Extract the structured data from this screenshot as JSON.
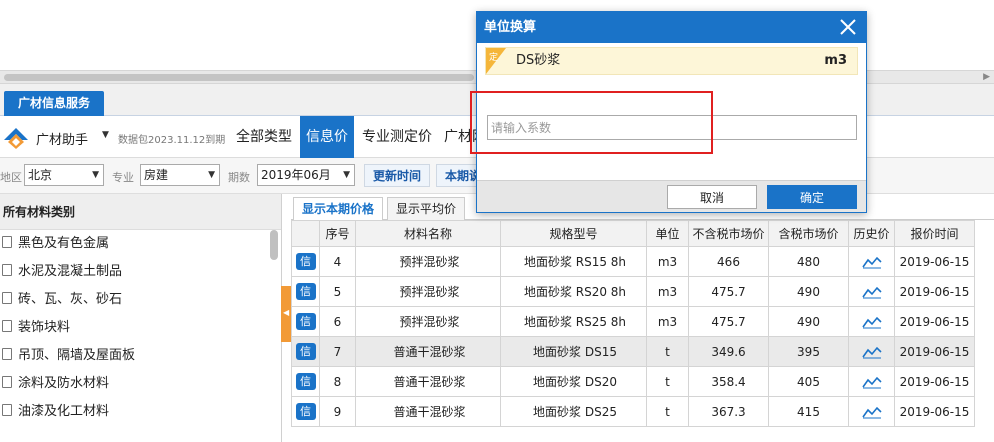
{
  "app_tab": "广材信息服务",
  "toolbar": {
    "brand": "广材助手",
    "data_package": "数据包2023.11.12到期",
    "tabs": [
      "全部类型",
      "信息价",
      "专业测定价",
      "广材网"
    ],
    "active_tab": "信息价"
  },
  "filters": {
    "region_label": "地区",
    "region_value": "北京",
    "major_label": "专业",
    "major_value": "房建",
    "period_label": "期数",
    "period_value": "2019年06月",
    "update_button": "更新时间",
    "current_button": "本期说明"
  },
  "categories": {
    "header": "所有材料类别",
    "items": [
      "黑色及有色金属",
      "水泥及混凝土制品",
      "砖、瓦、灰、砂石",
      "装饰块料",
      "吊顶、隔墙及屋面板",
      "涂料及防水材料",
      "油漆及化工材料"
    ]
  },
  "subtabs": [
    "显示本期价格",
    "显示平均价"
  ],
  "table": {
    "columns": [
      "",
      "序号",
      "材料名称",
      "规格型号",
      "单位",
      "不含税市场价",
      "含税市场价",
      "历史价",
      "报价时间"
    ],
    "badge": "信",
    "rows": [
      {
        "no": "4",
        "name": "预拌混砂浆",
        "spec": "地面砂浆 RS15 8h",
        "unit": "m3",
        "price_ex": "466",
        "price_in": "480",
        "date": "2019-06-15"
      },
      {
        "no": "5",
        "name": "预拌混砂浆",
        "spec": "地面砂浆 RS20 8h",
        "unit": "m3",
        "price_ex": "475.7",
        "price_in": "490",
        "date": "2019-06-15"
      },
      {
        "no": "6",
        "name": "预拌混砂浆",
        "spec": "地面砂浆 RS25 8h",
        "unit": "m3",
        "price_ex": "475.7",
        "price_in": "490",
        "date": "2019-06-15"
      },
      {
        "no": "7",
        "name": "普通干混砂浆",
        "spec": "地面砂浆 DS15",
        "unit": "t",
        "price_ex": "349.6",
        "price_in": "395",
        "date": "2019-06-15"
      },
      {
        "no": "8",
        "name": "普通干混砂浆",
        "spec": "地面砂浆 DS20",
        "unit": "t",
        "price_ex": "358.4",
        "price_in": "405",
        "date": "2019-06-15"
      },
      {
        "no": "9",
        "name": "普通干混砂浆",
        "spec": "地面砂浆 DS25",
        "unit": "t",
        "price_ex": "367.3",
        "price_in": "415",
        "date": "2019-06-15"
      }
    ]
  },
  "dialog": {
    "title": "单位换算",
    "tag": "定",
    "material_name": "DS砂浆",
    "material_unit": "m3",
    "input_placeholder": "请输入系数",
    "input_value": "",
    "cancel": "取消",
    "ok": "确定"
  },
  "colors": {
    "accent": "#1a73c8",
    "highlight_row": "#eaeaea",
    "splitter": "#f29a36",
    "annotation": "#e02020"
  }
}
